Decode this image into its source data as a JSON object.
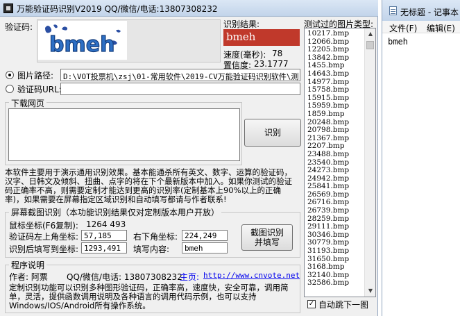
{
  "window": {
    "title": "万能验证码识别V2019    QQ/微信/电话:13807308232"
  },
  "captcha": {
    "label": "验证码:",
    "image_text": "bmeh"
  },
  "result": {
    "label": "识别结果:",
    "value": "bmeh",
    "speed_label": "速度(毫秒):",
    "speed_value": "78",
    "confidence_label": "置信度:",
    "confidence_value": "23.1777"
  },
  "source": {
    "path_label": "图片路径:",
    "path_value": "D:\\VOT投票机\\zsj\\01-常用软件\\2019-CV万能验证码识别软件\\测",
    "url_label": "验证码URL:",
    "url_value": ""
  },
  "download": {
    "group_title": "下载网页",
    "content": "",
    "recognize_button": "识别"
  },
  "description": "本软件主要用于演示通用识别效果。基本能通杀所有英文、数字、运算的验证码，汉字、日韩文及倾斜、扭曲、点字的将在下个最新版本中加入。如果你测试的验证码正确率不高，则需要定制才能达到更高的识别率(定制基本上90%以上的正确率)，如果需要在屏幕指定区域识别和自动填写都请与作者联系!",
  "screen_capture": {
    "group_title": "屏幕截图识别（本功能识别结果仅对定制版本用户开放）",
    "mouse_label": "鼠标坐标(F6复制):",
    "mouse_value": "1264  493",
    "top_left_label": "验证码左上角坐标:",
    "top_left_value": "57,185",
    "bottom_right_label": "右下角坐标:",
    "bottom_right_value": "224,249",
    "fill_coord_label": "识别后填写到坐标:",
    "fill_coord_value": "1293,491",
    "fill_content_label": "填写内容:",
    "fill_content_value": "bmeh",
    "capture_button": "截图识别并填写"
  },
  "program_info": {
    "group_title": "程序说明",
    "author": "作者: 阿票",
    "contact": "QQ/微信/电话: 13807308232",
    "homepage_label": "主页:",
    "homepage_url": "http://www.cnvote.net",
    "text": "定制识别功能可以识别多种图形验证码，正确率高，速度快，安全可靠，调用简单，灵活，提供函数调用说明及各种语言的调用代码示例，也可以支持Windows/IOS/Android所有操作系统。"
  },
  "tested_files": {
    "label": "测试过的图片类型:",
    "files": [
      "10217.bmp",
      "12066.bmp",
      "12205.bmp",
      "13842.bmp",
      "1455.bmp",
      "14643.bmp",
      "14977.bmp",
      "15758.bmp",
      "15915.bmp",
      "15959.bmp",
      "1859.bmp",
      "20248.bmp",
      "20798.bmp",
      "21367.bmp",
      "2207.bmp",
      "23488.bmp",
      "23540.bmp",
      "24273.bmp",
      "24942.bmp",
      "25841.bmp",
      "26569.bmp",
      "26716.bmp",
      "26739.bmp",
      "28259.bmp",
      "29111.bmp",
      "30346.bmp",
      "30779.bmp",
      "31193.bmp",
      "31650.bmp",
      "3168.bmp",
      "32140.bmp",
      "32586.bmp"
    ],
    "auto_next_label": "自动跳下一图",
    "auto_next_checked": true
  },
  "notepad": {
    "title": "无标题 - 记事本",
    "menu": [
      "文件(F)",
      "编辑(E)"
    ],
    "content": "bmeh"
  }
}
